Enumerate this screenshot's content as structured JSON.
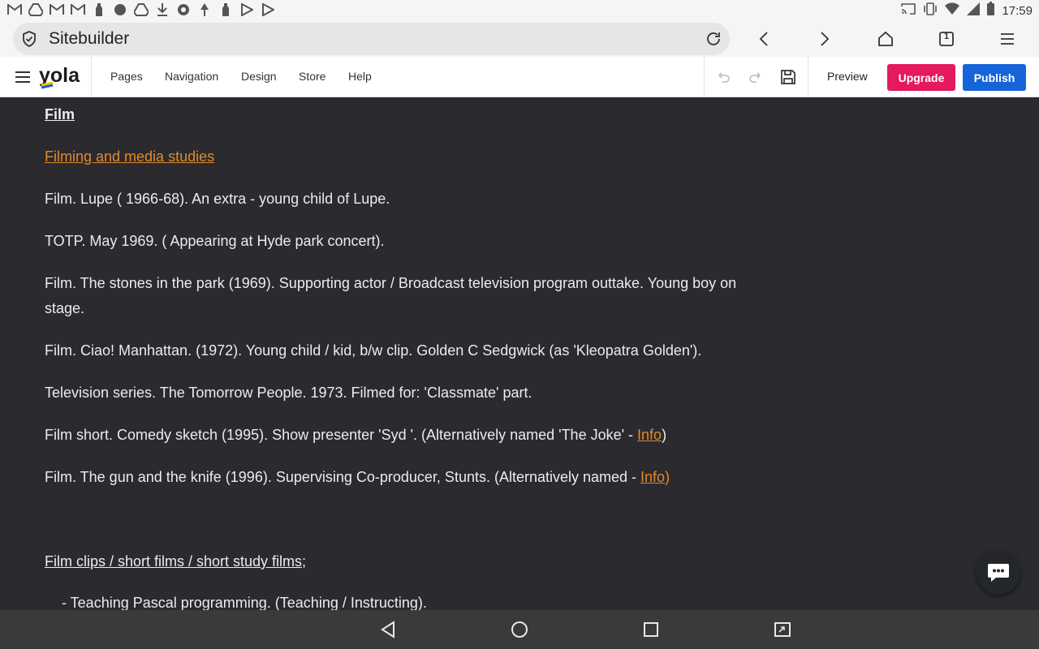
{
  "status_bar": {
    "left_icons": [
      "gmail-icon",
      "drive-icon",
      "gmail-icon",
      "gmail-icon",
      "bottle-icon",
      "android-icon",
      "drive-icon",
      "download-icon",
      "aperture-icon",
      "pin-icon",
      "bottle-icon",
      "play-icon",
      "play-icon"
    ],
    "time": "17:59"
  },
  "browser": {
    "url": "Sitebuilder",
    "tab_count": "1"
  },
  "editor": {
    "logo": "yola",
    "nav": [
      "Pages",
      "Navigation",
      "Design",
      "Store",
      "Help"
    ],
    "preview_label": "Preview",
    "upgrade_label": "Upgrade",
    "publish_label": "Publish",
    "colors": {
      "upgrade": "#e5195e",
      "publish": "#1565d8"
    }
  },
  "content": {
    "title": "Film",
    "subtitle_link": "Filming and media studies",
    "entries": [
      "Film. Lupe ( 1966-68).  An extra - young child of Lupe.",
      "TOTP.  May 1969.  ( Appearing at Hyde park concert).",
      "Film. The stones in the park (1969). Supporting actor / Broadcast television program outtake. Young boy on stage.",
      "Film.  Ciao! Manhattan.  (1972). Young child / kid, b/w clip.  Golden C Sedgwick (as  'Kleopatra Golden').",
      "Television series. The Tomorrow People. 1973.  Filmed for:  'Classmate' part."
    ],
    "entry_with_link_1": {
      "text": "Film short.  Comedy sketch  (1995).  Show presenter 'Syd '.  (Alternatively named 'The Joke' - ",
      "link": "Info",
      "after": ")"
    },
    "entry_with_link_2": {
      "text": "Film.  The gun and the knife (1996).  Supervising Co-producer,  Stunts.  (Alternatively named -  ",
      "link": "Info",
      "after": ")"
    },
    "section_heading": "Film clips / short films / short study films; ",
    "list_items": [
      "-  Teaching Pascal programming.  (Teaching / Instructing)."
    ],
    "colors": {
      "background": "#2a2a2f",
      "text": "#ececec",
      "link": "#e08a2e"
    }
  }
}
